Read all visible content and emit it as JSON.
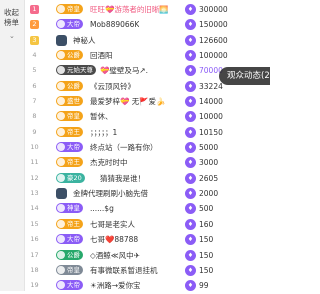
{
  "left_tab": {
    "label": "收起榜单",
    "chevron": "⌄"
  },
  "coin_icon": "violet-coin-icon",
  "rows": [
    {
      "rank": "1",
      "badge": "帝皇",
      "badge_color": "#f4a31a",
      "name": "旺旺💝游荡者的旧晰🌅",
      "amount": "300000"
    },
    {
      "rank": "2",
      "badge": "大帝",
      "badge_color": "#8b5cf6",
      "name": "Mob889066K",
      "amount": "150000"
    },
    {
      "rank": "3",
      "badge": "",
      "badge_color": "",
      "name": "神秘人",
      "amount": "126600"
    },
    {
      "rank": "4",
      "badge": "公爵",
      "badge_color": "#f4a31a",
      "name": "回酒阳",
      "amount": "100000"
    },
    {
      "rank": "5",
      "badge": "元始天尊",
      "badge_color": "#4a4a4a",
      "name": "💝璧壁及马↗.",
      "amount": "70000"
    },
    {
      "rank": "6",
      "badge": "公爵",
      "badge_color": "#f4a31a",
      "name": "《云顶风铃》",
      "amount": "33224"
    },
    {
      "rank": "7",
      "badge": "盛世",
      "badge_color": "#f4a31a",
      "name": "最爱梦梓💝 无🚩爱🍌",
      "amount": "14000"
    },
    {
      "rank": "8",
      "badge": "帝皇",
      "badge_color": "#f4a31a",
      "name": "暂休、",
      "amount": "10000"
    },
    {
      "rank": "9",
      "badge": "帝王",
      "badge_color": "#f4a31a",
      "name": "；；；；；1",
      "amount": "10150"
    },
    {
      "rank": "10",
      "badge": "大帝",
      "badge_color": "#8b5cf6",
      "name": "终点站（一路有你）",
      "amount": "5000"
    },
    {
      "rank": "11",
      "badge": "帝王",
      "badge_color": "#f4a31a",
      "name": "杰克时时中",
      "amount": "3000"
    },
    {
      "rank": "12",
      "badge": "豪20",
      "badge_color": "#3bb3a0",
      "name": "猜猜我是谁！",
      "amount": "2605"
    },
    {
      "rank": "13",
      "badge": "",
      "badge_color": "",
      "name": "金牌代理刷刷小脑先借",
      "amount": "2000"
    },
    {
      "rank": "14",
      "badge": "神皇",
      "badge_color": "#8b5cf6",
      "name": "......$g",
      "amount": "500"
    },
    {
      "rank": "15",
      "badge": "帝王",
      "badge_color": "#f4a31a",
      "name": "七哥是老实人",
      "amount": "160"
    },
    {
      "rank": "16",
      "badge": "大帝",
      "badge_color": "#8b5cf6",
      "name": "七哥❤️88788",
      "amount": "150"
    },
    {
      "rank": "17",
      "badge": "公爵",
      "badge_color": "#27a86b",
      "name": "◇酒鲸≪风中✈",
      "amount": "150"
    },
    {
      "rank": "18",
      "badge": "帝皇",
      "badge_color": "#7f8a96",
      "name": "有事微联系暂退挂机",
      "amount": "150"
    },
    {
      "rank": "19",
      "badge": "大帝",
      "badge_color": "#8b5cf6",
      "name": "☀洲路→爱你宝",
      "amount": "99"
    }
  ],
  "popup": {
    "label": "观众动态(2"
  }
}
